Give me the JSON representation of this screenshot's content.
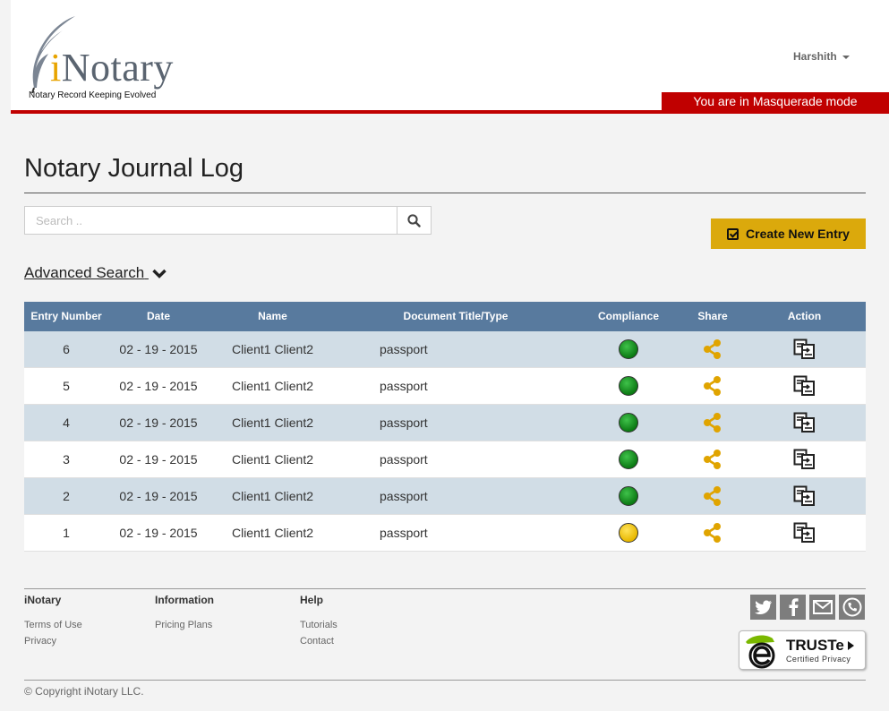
{
  "brand": {
    "name_prefix": "i",
    "name_rest": "Notary",
    "tagline": "Notary Record Keeping Evolved",
    "accent": "#e8a400"
  },
  "header": {
    "user_name": "Harshith",
    "masquerade_text": "You are in Masquerade mode",
    "masquerade_color": "#c00000"
  },
  "page": {
    "title": "Notary Journal Log"
  },
  "search": {
    "placeholder": "Search ..",
    "value": "",
    "icon": "search-icon"
  },
  "create_button": {
    "label": "Create New Entry",
    "icon": "checkbox-icon",
    "color": "#dba90c"
  },
  "advanced_search": {
    "label": "Advanced Search",
    "icon": "chevron-down-icon"
  },
  "table": {
    "header_color": "#587a9e",
    "columns": [
      "Entry Number",
      "Date",
      "Name",
      "Document Title/Type",
      "Compliance",
      "Share",
      "Action"
    ],
    "rows": [
      {
        "entry": "6",
        "date": "02 - 19 - 2015",
        "name": "Client1 Client2",
        "doc": "passport",
        "compliance": "green"
      },
      {
        "entry": "5",
        "date": "02 - 19 - 2015",
        "name": "Client1 Client2",
        "doc": "passport",
        "compliance": "green"
      },
      {
        "entry": "4",
        "date": "02 - 19 - 2015",
        "name": "Client1 Client2",
        "doc": "passport",
        "compliance": "green"
      },
      {
        "entry": "3",
        "date": "02 - 19 - 2015",
        "name": "Client1 Client2",
        "doc": "passport",
        "compliance": "green"
      },
      {
        "entry": "2",
        "date": "02 - 19 - 2015",
        "name": "Client1 Client2",
        "doc": "passport",
        "compliance": "green"
      },
      {
        "entry": "1",
        "date": "02 - 19 - 2015",
        "name": "Client1 Client2",
        "doc": "passport",
        "compliance": "yellow"
      }
    ],
    "share_icon": "share-icon",
    "action_icon": "document-transfer-icon"
  },
  "footer": {
    "col1": {
      "heading": "iNotary",
      "links": [
        "Terms of Use",
        "Privacy"
      ]
    },
    "col2": {
      "heading": "Information",
      "links": [
        "Pricing Plans"
      ]
    },
    "col3": {
      "heading": "Help",
      "links": [
        "Tutorials",
        "Contact"
      ]
    },
    "social": [
      "twitter-icon",
      "facebook-icon",
      "email-icon",
      "phone-icon"
    ],
    "truste": {
      "title": "TRUSTe",
      "subtitle": "Certified Privacy"
    },
    "copyright": "© Copyright iNotary LLC."
  }
}
